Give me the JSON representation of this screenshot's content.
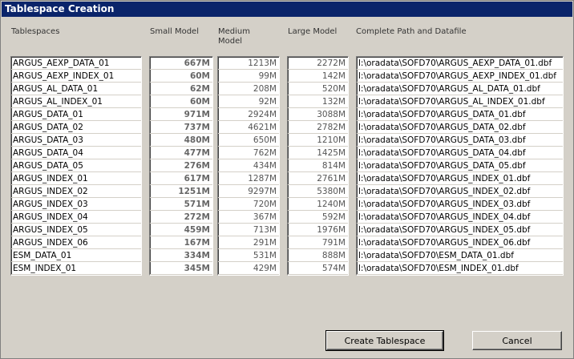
{
  "title": "Tablespace Creation",
  "headers": {
    "tablespaces": "Tablespaces",
    "small": "Small Model",
    "medium": "Medium Model",
    "large": "Large Model",
    "path": "Complete Path and Datafile"
  },
  "rows": [
    {
      "name": "ARGUS_AEXP_DATA_01",
      "small": "667M",
      "medium": "1213M",
      "large": "2272M",
      "path": "l:\\oradata\\SOFD70\\ARGUS_AEXP_DATA_01.dbf"
    },
    {
      "name": "ARGUS_AEXP_INDEX_01",
      "small": "60M",
      "medium": "99M",
      "large": "142M",
      "path": "l:\\oradata\\SOFD70\\ARGUS_AEXP_INDEX_01.dbf"
    },
    {
      "name": "ARGUS_AL_DATA_01",
      "small": "62M",
      "medium": "208M",
      "large": "520M",
      "path": "l:\\oradata\\SOFD70\\ARGUS_AL_DATA_01.dbf"
    },
    {
      "name": "ARGUS_AL_INDEX_01",
      "small": "60M",
      "medium": "92M",
      "large": "132M",
      "path": "l:\\oradata\\SOFD70\\ARGUS_AL_INDEX_01.dbf"
    },
    {
      "name": "ARGUS_DATA_01",
      "small": "971M",
      "medium": "2924M",
      "large": "3088M",
      "path": "l:\\oradata\\SOFD70\\ARGUS_DATA_01.dbf"
    },
    {
      "name": "ARGUS_DATA_02",
      "small": "737M",
      "medium": "4621M",
      "large": "2782M",
      "path": "l:\\oradata\\SOFD70\\ARGUS_DATA_02.dbf"
    },
    {
      "name": "ARGUS_DATA_03",
      "small": "480M",
      "medium": "650M",
      "large": "1210M",
      "path": "l:\\oradata\\SOFD70\\ARGUS_DATA_03.dbf"
    },
    {
      "name": "ARGUS_DATA_04",
      "small": "477M",
      "medium": "762M",
      "large": "1425M",
      "path": "l:\\oradata\\SOFD70\\ARGUS_DATA_04.dbf"
    },
    {
      "name": "ARGUS_DATA_05",
      "small": "276M",
      "medium": "434M",
      "large": "814M",
      "path": "l:\\oradata\\SOFD70\\ARGUS_DATA_05.dbf"
    },
    {
      "name": "ARGUS_INDEX_01",
      "small": "617M",
      "medium": "1287M",
      "large": "2761M",
      "path": "l:\\oradata\\SOFD70\\ARGUS_INDEX_01.dbf"
    },
    {
      "name": "ARGUS_INDEX_02",
      "small": "1251M",
      "medium": "9297M",
      "large": "5380M",
      "path": "l:\\oradata\\SOFD70\\ARGUS_INDEX_02.dbf"
    },
    {
      "name": "ARGUS_INDEX_03",
      "small": "571M",
      "medium": "720M",
      "large": "1240M",
      "path": "l:\\oradata\\SOFD70\\ARGUS_INDEX_03.dbf"
    },
    {
      "name": "ARGUS_INDEX_04",
      "small": "272M",
      "medium": "367M",
      "large": "592M",
      "path": "l:\\oradata\\SOFD70\\ARGUS_INDEX_04.dbf"
    },
    {
      "name": "ARGUS_INDEX_05",
      "small": "459M",
      "medium": "713M",
      "large": "1976M",
      "path": "l:\\oradata\\SOFD70\\ARGUS_INDEX_05.dbf"
    },
    {
      "name": "ARGUS_INDEX_06",
      "small": "167M",
      "medium": "291M",
      "large": "791M",
      "path": "l:\\oradata\\SOFD70\\ARGUS_INDEX_06.dbf"
    },
    {
      "name": "ESM_DATA_01",
      "small": "334M",
      "medium": "531M",
      "large": "888M",
      "path": "l:\\oradata\\SOFD70\\ESM_DATA_01.dbf"
    },
    {
      "name": "ESM_INDEX_01",
      "small": "345M",
      "medium": "429M",
      "large": "574M",
      "path": "l:\\oradata\\SOFD70\\ESM_INDEX_01.dbf"
    }
  ],
  "buttons": {
    "create": "Create Tablespace",
    "cancel": "Cancel"
  }
}
